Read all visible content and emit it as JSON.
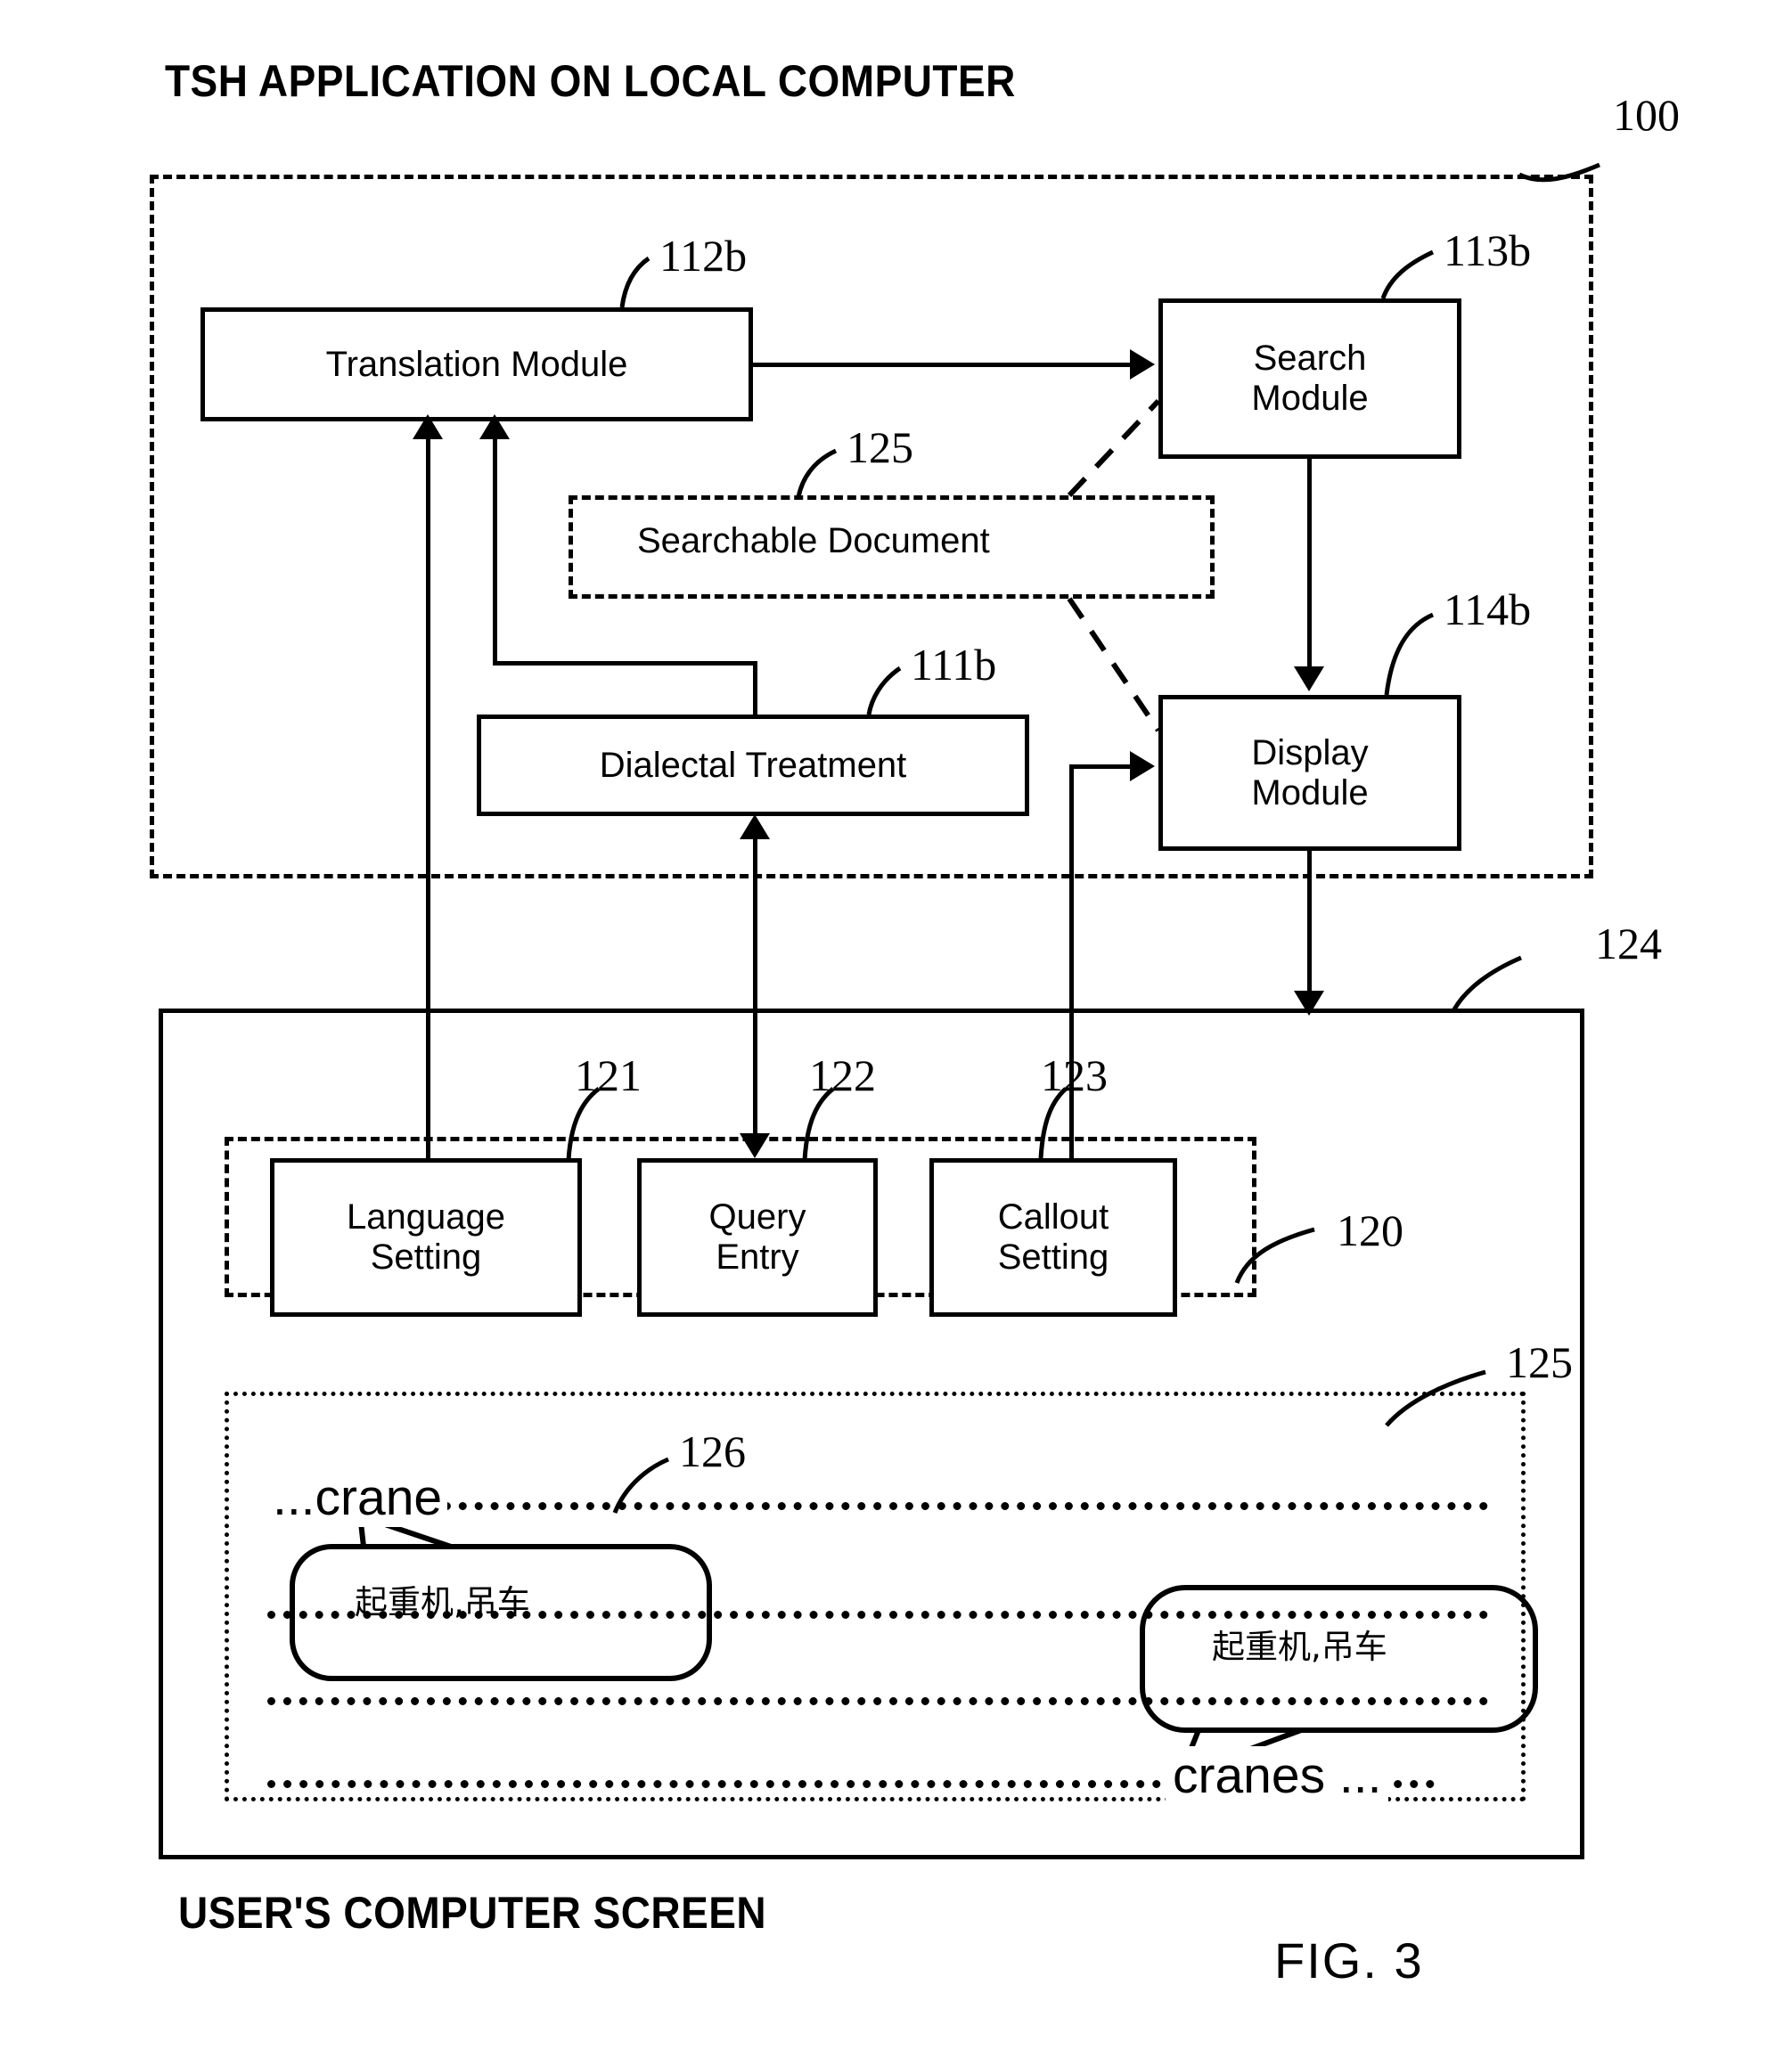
{
  "figure": {
    "number": "FIG. 3",
    "top_caption": "TSH APPLICATION ON LOCAL COMPUTER",
    "bottom_caption": "USER'S COMPUTER SCREEN"
  },
  "application": {
    "ref": "100",
    "modules": [
      {
        "ref": "112b",
        "label": "Translation Module"
      },
      {
        "ref": "113b",
        "label": "Search\nModule",
        "line1": "Search",
        "line2": "Module"
      },
      {
        "ref": "111b",
        "label": "Dialectal Treatment"
      },
      {
        "ref": "114b",
        "label": "Display\nModule",
        "line1": "Display",
        "line2": "Module"
      }
    ],
    "searchable_document": {
      "ref": "125",
      "label": "Searchable Document"
    }
  },
  "screen": {
    "ref": "124",
    "controls_group_ref": "120",
    "controls": [
      {
        "ref": "121",
        "line1": "Language",
        "line2": "Setting"
      },
      {
        "ref": "122",
        "line1": "Query",
        "line2": "Entry"
      },
      {
        "ref": "123",
        "line1": "Callout",
        "line2": "Setting"
      }
    ],
    "document": {
      "ref": "125",
      "callout_ref": "126",
      "word_singular": "...crane",
      "word_plural": "cranes ...",
      "callout_text_1": "起重机,吊车",
      "callout_text_2": "起重机,吊车"
    }
  }
}
